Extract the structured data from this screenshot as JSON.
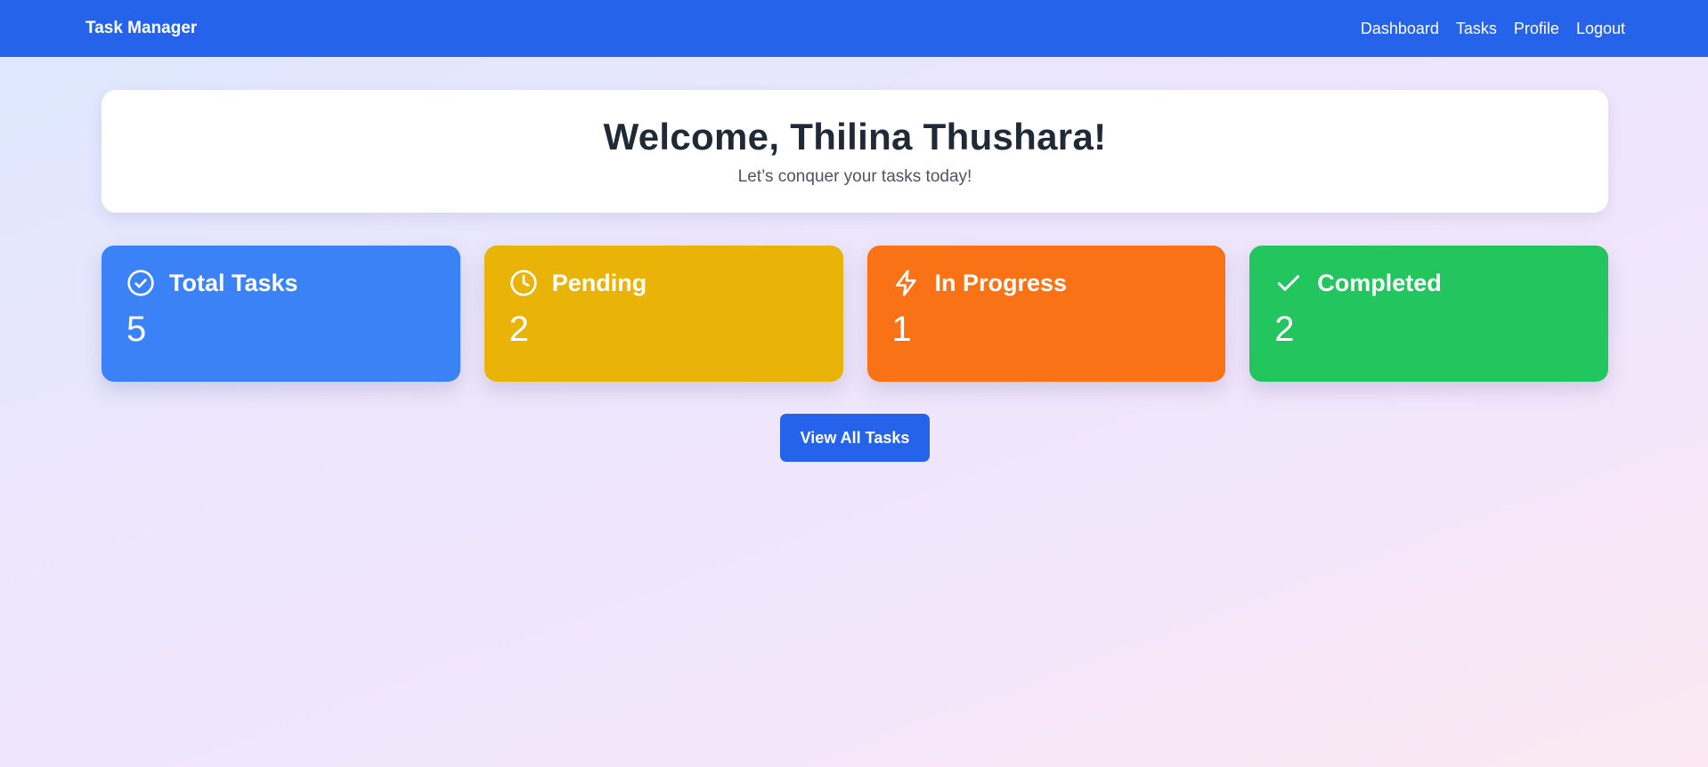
{
  "nav": {
    "brand": "Task Manager",
    "links": [
      "Dashboard",
      "Tasks",
      "Profile",
      "Logout"
    ],
    "color": "#2563eb"
  },
  "welcome": {
    "title": "Welcome, Thilina Thushara!",
    "subtitle": "Let’s conquer your tasks today!"
  },
  "stats": [
    {
      "label": "Total Tasks",
      "value": "5",
      "icon": "check-circle-icon",
      "color": "#3b82f6"
    },
    {
      "label": "Pending",
      "value": "2",
      "icon": "clock-icon",
      "color": "#eab308"
    },
    {
      "label": "In Progress",
      "value": "1",
      "icon": "lightning-icon",
      "color": "#f97316"
    },
    {
      "label": "Completed",
      "value": "2",
      "icon": "checkmark-icon",
      "color": "#22c55e"
    }
  ],
  "actions": {
    "view_all_label": "View All Tasks",
    "color": "#2563eb"
  }
}
